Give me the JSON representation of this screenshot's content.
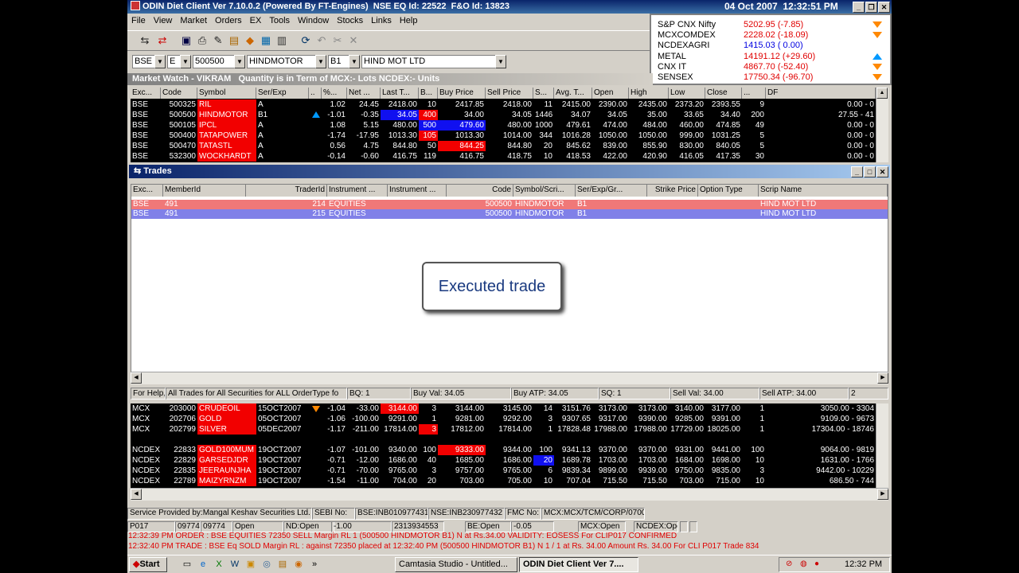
{
  "app": {
    "title": "ODIN Diet Client Ver 7.10.0.2 (Powered By FT-Engines)",
    "nse_eq_id": "NSE EQ Id: 22522",
    "fo_id": "F&O Id: 13823",
    "date": "04 Oct 2007",
    "time": "12:32:51 PM"
  },
  "menu": [
    "File",
    "View",
    "Market",
    "Orders",
    "EX",
    "Tools",
    "Window",
    "Stocks",
    "Links",
    "Help"
  ],
  "toolbar_icons": [
    "buy-sell-icon",
    "market-icon",
    "save-icon",
    "print-icon",
    "edit-icon",
    "report-icon",
    "chart-icon",
    "graph-icon",
    "book-icon",
    "refresh-icon",
    "undo-icon",
    "cancel-icon",
    "close-icon"
  ],
  "ticker": [
    {
      "name": "S&P CNX Nifty",
      "value": "5202.95 (-7.85)",
      "color": "#e00000",
      "dir": "down"
    },
    {
      "name": "MCXCOMDEX",
      "value": "2228.02 (-18.09)",
      "color": "#e00000",
      "dir": "down"
    },
    {
      "name": "NCDEXAGRI",
      "value": "1415.03 ( 0.00)",
      "color": "#0000e0",
      "dir": "none"
    },
    {
      "name": "METAL",
      "value": "14191.12 (+29.60)",
      "color": "#e00000",
      "dir": "up"
    },
    {
      "name": "CNX IT",
      "value": "4867.70 (-52.40)",
      "color": "#e00000",
      "dir": "down"
    },
    {
      "name": "SENSEX",
      "value": "17750.34 (-96.70)",
      "color": "#e00000",
      "dir": "down"
    }
  ],
  "selectors": {
    "exchange": "BSE",
    "segment": "E",
    "code": "500500",
    "symbol": "HINDMOTOR",
    "series": "B1",
    "scrip": "HIND MOT LTD"
  },
  "market_watch": {
    "title": "Market Watch - VIKRAM",
    "quantity_note": "Quantity is in Term of MCX:- Lots NCDEX:- Units",
    "columns": [
      "Exc...",
      "Code",
      "Symbol",
      "Ser/Exp",
      "..",
      "%...",
      "Net ...",
      "Last T...",
      "B...",
      "Buy Price",
      "Sell Price",
      "S...",
      "Avg. T...",
      "Open",
      "High",
      "Low",
      "Close",
      "...",
      "DF"
    ],
    "rows": [
      [
        "BSE",
        "500325",
        "RIL",
        "A",
        "",
        "1.02",
        "24.45",
        "2418.00",
        "10",
        "2417.85",
        "2418.00",
        "11",
        "2415.00",
        "2390.00",
        "2435.00",
        "2373.20",
        "2393.55",
        "9",
        "0.00 - 0"
      ],
      [
        "BSE",
        "500500",
        "HINDMOTOR",
        "B1",
        "",
        "-1.01",
        "-0.35",
        "34.05",
        "400",
        "34.00",
        "34.05",
        "1446",
        "34.07",
        "34.05",
        "35.00",
        "33.65",
        "34.40",
        "200",
        "27.55 - 41"
      ],
      [
        "BSE",
        "500105",
        "IPCL",
        "A",
        "",
        "1.08",
        "5.15",
        "480.00",
        "500",
        "479.60",
        "480.00",
        "1000",
        "479.61",
        "474.00",
        "484.00",
        "460.00",
        "474.85",
        "49",
        "0.00 - 0"
      ],
      [
        "BSE",
        "500400",
        "TATAPOWER",
        "A",
        "",
        "-1.74",
        "-17.95",
        "1013.30",
        "105",
        "1013.30",
        "1014.00",
        "344",
        "1016.28",
        "1050.00",
        "1050.00",
        "999.00",
        "1031.25",
        "5",
        "0.00 - 0"
      ],
      [
        "BSE",
        "500470",
        "TATASTL",
        "A",
        "",
        "0.56",
        "4.75",
        "844.80",
        "50",
        "844.25",
        "844.80",
        "20",
        "845.62",
        "839.00",
        "855.90",
        "830.00",
        "840.05",
        "5",
        "0.00 - 0"
      ],
      [
        "BSE",
        "532300",
        "WOCKHARDT",
        "A",
        "",
        "-0.14",
        "-0.60",
        "416.75",
        "119",
        "416.75",
        "418.75",
        "10",
        "418.53",
        "422.00",
        "420.90",
        "416.05",
        "417.35",
        "30",
        "0.00 - 0"
      ]
    ],
    "lower_rows": [
      [
        "MCX",
        "203000",
        "CRUDEOIL",
        "15OCT2007",
        "",
        "-1.04",
        "-33.00",
        "3144.00",
        "3",
        "3144.00",
        "3145.00",
        "14",
        "3151.76",
        "3173.00",
        "3173.00",
        "3140.00",
        "3177.00",
        "1",
        "3050.00 - 3304"
      ],
      [
        "MCX",
        "202706",
        "GOLD",
        "05OCT2007",
        "",
        "-1.06",
        "-100.00",
        "9291.00",
        "1",
        "9281.00",
        "9292.00",
        "3",
        "9307.65",
        "9317.00",
        "9390.00",
        "9285.00",
        "9391.00",
        "1",
        "9109.00 - 9673"
      ],
      [
        "MCX",
        "202799",
        "SILVER",
        "05DEC2007",
        "",
        "-1.17",
        "-211.00",
        "17814.00",
        "3",
        "17812.00",
        "17814.00",
        "1",
        "17828.48",
        "17988.00",
        "17988.00",
        "17729.00",
        "18025.00",
        "1",
        "17304.00 - 18746"
      ],
      [
        "",
        "",
        "",
        "",
        "",
        "",
        "",
        "",
        "",
        "",
        "",
        "",
        "",
        "",
        "",
        "",
        "",
        "",
        ""
      ],
      [
        "NCDEX",
        "22833",
        "GOLD100MUM",
        "19OCT2007",
        "",
        "-1.07",
        "-101.00",
        "9340.00",
        "100",
        "9333.00",
        "9344.00",
        "100",
        "9341.13",
        "9370.00",
        "9370.00",
        "9331.00",
        "9441.00",
        "100",
        "9064.00 - 9819"
      ],
      [
        "NCDEX",
        "22829",
        "GARSEDJDR",
        "19OCT2007",
        "",
        "-0.71",
        "-12.00",
        "1686.00",
        "40",
        "1685.00",
        "1686.00",
        "20",
        "1689.78",
        "1703.00",
        "1703.00",
        "1684.00",
        "1698.00",
        "10",
        "1631.00 - 1766"
      ],
      [
        "NCDEX",
        "22835",
        "JEERAUNJHA",
        "19OCT2007",
        "",
        "-0.71",
        "-70.00",
        "9765.00",
        "3",
        "9757.00",
        "9765.00",
        "6",
        "9839.34",
        "9899.00",
        "9939.00",
        "9750.00",
        "9835.00",
        "3",
        "9442.00 - 10229"
      ],
      [
        "NCDEX",
        "22789",
        "MAIZYRNZM",
        "19OCT2007",
        "",
        "-1.54",
        "-11.00",
        "704.00",
        "20",
        "703.00",
        "705.00",
        "10",
        "707.04",
        "715.50",
        "715.50",
        "703.00",
        "715.00",
        "10",
        "686.50 - 744"
      ]
    ]
  },
  "trades": {
    "title": "Trades",
    "columns": [
      "Exc...",
      "MemberId",
      "TraderId",
      "Instrument ...",
      "Instrument ...",
      "Code",
      "Symbol/Scri...",
      "Ser/Exp/Gr...",
      "Strike Price",
      "Option Type",
      "Scrip Name"
    ],
    "rows": [
      {
        "exc": "BSE",
        "member": "491",
        "trader": "214",
        "instrument": "EQUITIES",
        "code": "500500",
        "symbol": "HINDMOTOR",
        "series": "B1",
        "scrip": "HIND MOT LTD",
        "color": "#f07878"
      },
      {
        "exc": "BSE",
        "member": "491",
        "trader": "215",
        "instrument": "EQUITIES",
        "code": "500500",
        "symbol": "HINDMOTOR",
        "series": "B1",
        "scrip": "HIND MOT LTD",
        "color": "#8080e8"
      }
    ]
  },
  "callout": "Executed trade",
  "trades_status": {
    "help": "For Help,",
    "filter": "All Trades for All Securities for  ALL OrderType  fo",
    "bq": "BQ: 1",
    "buy_val": "Buy Val: 34.05",
    "buy_atp": "Buy ATP: 34.05",
    "sq": "SQ: 1",
    "sell_val": "Sell Val: 34.00",
    "sell_atp": "Sell ATP: 34.00",
    "count": "2"
  },
  "service": {
    "provider": "Service Provided by:Mangal Keshav Securities Ltd.",
    "sebi": "SEBI No:",
    "bse": "BSE:INB010977431",
    "nse": "NSE:INB230977432",
    "fmc": "FMC No:",
    "mcx": "MCX:MCX/TCM/CORP/0700"
  },
  "info": [
    "P017",
    "09774",
    "09774",
    "Open",
    "ND:Open",
    "-1.00",
    "2313934553",
    "BE:Open",
    "-0.05",
    "MCX:Open",
    "NCDEX:Open"
  ],
  "messages": [
    "12:32:39 PM ORDER : BSE EQUITIES 72350 SELL Margin  RL  1 (500500 HINDMOTOR B1) N at Rs.34.00 VALIDITY: EOSESS For CLIP017 CONFIRMED",
    "12:32:40 PM TRADE : BSE Eq SOLD Margin   RL  : against 72350 placed at 12:32:40 PM  (500500 HINDMOTOR B1) N 1 / 1 at Rs. 34.00  Amount Rs. 34.00 For CLI P017 Trade 834"
  ],
  "taskbar": {
    "start": "Start",
    "tasks": [
      "Camtasia Studio - Untitled...",
      "ODIN Diet Client Ver 7...."
    ],
    "clock": "12:32 PM"
  }
}
